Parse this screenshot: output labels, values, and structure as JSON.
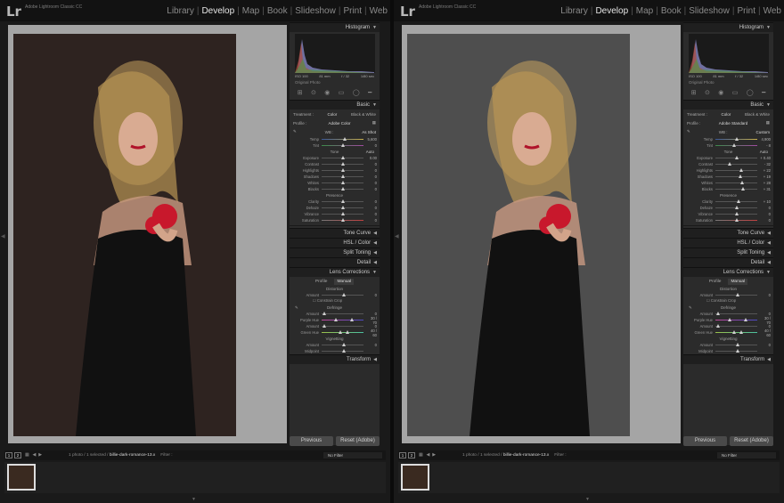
{
  "left": {
    "app_title": "Adobe Lightroom Classic CC",
    "logo": "Lr",
    "modules": [
      "Library",
      "Develop",
      "Map",
      "Book",
      "Slideshow",
      "Print",
      "Web"
    ],
    "active_module": "Develop",
    "histogram": {
      "title": "Histogram",
      "iso": "ISO 100",
      "shutter": "1/80 sec",
      "aperture": "f / 32",
      "focal": "81 mm",
      "original_photo": "Original Photo"
    },
    "basic": {
      "title": "Basic",
      "treatment_label": "Treatment :",
      "treatment_color": "Color",
      "treatment_bw": "Black & White",
      "profile_label": "Profile :",
      "profile_value": "Adobe Color",
      "wb_label": "WB :",
      "wb_value": "As Shot",
      "temp_label": "Temp",
      "temp_value": "5,600",
      "tint_label": "Tint",
      "tint_value": "0",
      "tone_label": "Tone",
      "auto_label": "Auto",
      "exposure_label": "Exposure",
      "exposure_value": "0.00",
      "contrast_label": "Contrast",
      "contrast_value": "0",
      "highlights_label": "Highlights",
      "highlights_value": "0",
      "shadows_label": "Shadows",
      "shadows_value": "0",
      "whites_label": "Whites",
      "whites_value": "0",
      "blacks_label": "Blacks",
      "blacks_value": "0",
      "presence_label": "Presence",
      "clarity_label": "Clarity",
      "clarity_value": "0",
      "dehaze_label": "Dehaze",
      "dehaze_value": "0",
      "vibrance_label": "Vibrance",
      "vibrance_value": "0",
      "saturation_label": "Saturation",
      "saturation_value": "0"
    },
    "panels": [
      "Tone Curve",
      "HSL / Color",
      "Split Toning",
      "Detail"
    ],
    "lens": {
      "title": "Lens Corrections",
      "tab_profile": "Profile",
      "tab_manual": "Manual",
      "distortion": "Distortion",
      "amount_label": "Amount",
      "amount_value": "0",
      "constrain": "Constrain Crop",
      "defringe": "Defringe",
      "purple_amount": "0",
      "purple_hue_label": "Purple Hue",
      "purple_hue_value": "30 / 70",
      "green_amount": "0",
      "green_hue_label": "Green Hue",
      "green_hue_value": "40 / 60",
      "vignetting": "Vignetting",
      "vig_amount": "0",
      "midpoint_label": "Midpoint"
    },
    "transform": "Transform",
    "buttons": {
      "previous": "Previous",
      "reset": "Reset (Adobe)"
    },
    "filmstrip": {
      "path_prefix": "1 photo / 1 selected /",
      "file": "billie-dark-romance-13.x",
      "filter": "Filter :",
      "no_filter": "No Filter"
    }
  },
  "right": {
    "app_title": "Adobe Lightroom Classic CC",
    "logo": "Lr",
    "modules": [
      "Library",
      "Develop",
      "Map",
      "Book",
      "Slideshow",
      "Print",
      "Web"
    ],
    "active_module": "Develop",
    "histogram": {
      "title": "Histogram",
      "iso": "ISO 100",
      "shutter": "1/80 sec",
      "aperture": "f / 32",
      "focal": "81 mm",
      "original_photo": "Original Photo"
    },
    "basic": {
      "title": "Basic",
      "treatment_label": "Treatment :",
      "treatment_color": "Color",
      "treatment_bw": "Black & White",
      "profile_label": "Profile :",
      "profile_value": "Adobe Standard",
      "wb_label": "WB :",
      "wb_value": "Custom",
      "temp_label": "Temp",
      "temp_value": "4,900",
      "tint_label": "Tint",
      "tint_value": "- 8",
      "tone_label": "Tone",
      "auto_label": "Auto",
      "exposure_label": "Exposure",
      "exposure_value": "+ 0.40",
      "contrast_label": "Contrast",
      "contrast_value": "- 32",
      "highlights_label": "Highlights",
      "highlights_value": "+ 22",
      "shadows_label": "Shadows",
      "shadows_value": "+ 19",
      "whites_label": "Whites",
      "whites_value": "+ 28",
      "blacks_label": "Blacks",
      "blacks_value": "+ 31",
      "presence_label": "Presence",
      "clarity_label": "Clarity",
      "clarity_value": "+ 10",
      "dehaze_label": "Dehaze",
      "dehaze_value": "0",
      "vibrance_label": "Vibrance",
      "vibrance_value": "0",
      "saturation_label": "Saturation",
      "saturation_value": "0"
    },
    "panels": [
      "Tone Curve",
      "HSL / Color",
      "Split Toning",
      "Detail"
    ],
    "lens": {
      "title": "Lens Corrections",
      "tab_profile": "Profile",
      "tab_manual": "Manual",
      "distortion": "Distortion",
      "amount_label": "Amount",
      "amount_value": "0",
      "constrain": "Constrain Crop",
      "defringe": "Defringe",
      "purple_amount": "0",
      "purple_hue_label": "Purple Hue",
      "purple_hue_value": "30 / 70",
      "green_amount": "0",
      "green_hue_label": "Green Hue",
      "green_hue_value": "40 / 60",
      "vignetting": "Vignetting",
      "vig_amount": "0",
      "midpoint_label": "Midpoint"
    },
    "transform": "Transform",
    "buttons": {
      "previous": "Previous",
      "reset": "Reset (Adobe)"
    },
    "filmstrip": {
      "path_prefix": "1 photo / 1 selected /",
      "file": "billie-dark-romance-13.x",
      "filter": "Filter :",
      "no_filter": "No Filter"
    }
  },
  "slider_levels": {
    "left": {
      "temp": 0.55,
      "tint": 0.5,
      "exposure": 0.5,
      "contrast": 0.5,
      "highlights": 0.5,
      "shadows": 0.5,
      "whites": 0.5,
      "blacks": 0.5,
      "clarity": 0.5,
      "dehaze": 0.5,
      "vibrance": 0.5,
      "saturation": 0.5
    },
    "right": {
      "temp": 0.5,
      "tint": 0.45,
      "exposure": 0.52,
      "contrast": 0.34,
      "highlights": 0.61,
      "shadows": 0.6,
      "whites": 0.64,
      "blacks": 0.66,
      "clarity": 0.55,
      "dehaze": 0.5,
      "vibrance": 0.5,
      "saturation": 0.5
    }
  },
  "colors": {
    "left_photo_bg": "#2e2320",
    "right_photo_bg": "#4e4e4e",
    "rose": "#c8182c"
  }
}
